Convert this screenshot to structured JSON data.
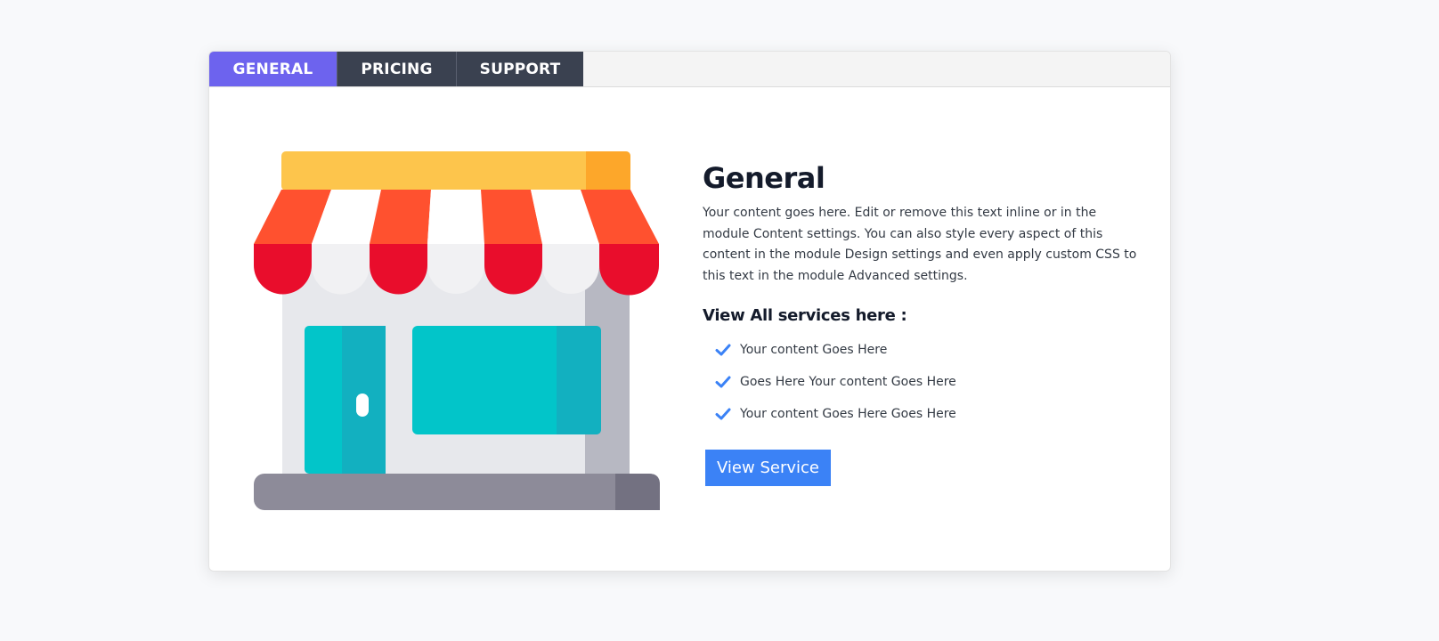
{
  "tabs": [
    {
      "label": "GENERAL",
      "active": true
    },
    {
      "label": "PRICING",
      "active": false
    },
    {
      "label": "SUPPORT",
      "active": false
    }
  ],
  "main": {
    "title": "General",
    "description": "Your content goes here. Edit or remove this text inline or in the module Content settings. You can also style every aspect of this content in the module Design settings and even apply custom CSS to this text in the module Advanced settings.",
    "subtitle": "View All services here :",
    "services": [
      "Your content Goes Here",
      "Goes Here Your content Goes Here",
      "Your content Goes Here Goes Here"
    ],
    "button_label": "View Service"
  },
  "icons": {
    "illustration": "storefront-icon",
    "bullet": "check-icon"
  },
  "colors": {
    "active_tab": "#6d63ee",
    "inactive_tab": "#3a4150",
    "button": "#3b82f6",
    "check": "#3b82f6"
  }
}
